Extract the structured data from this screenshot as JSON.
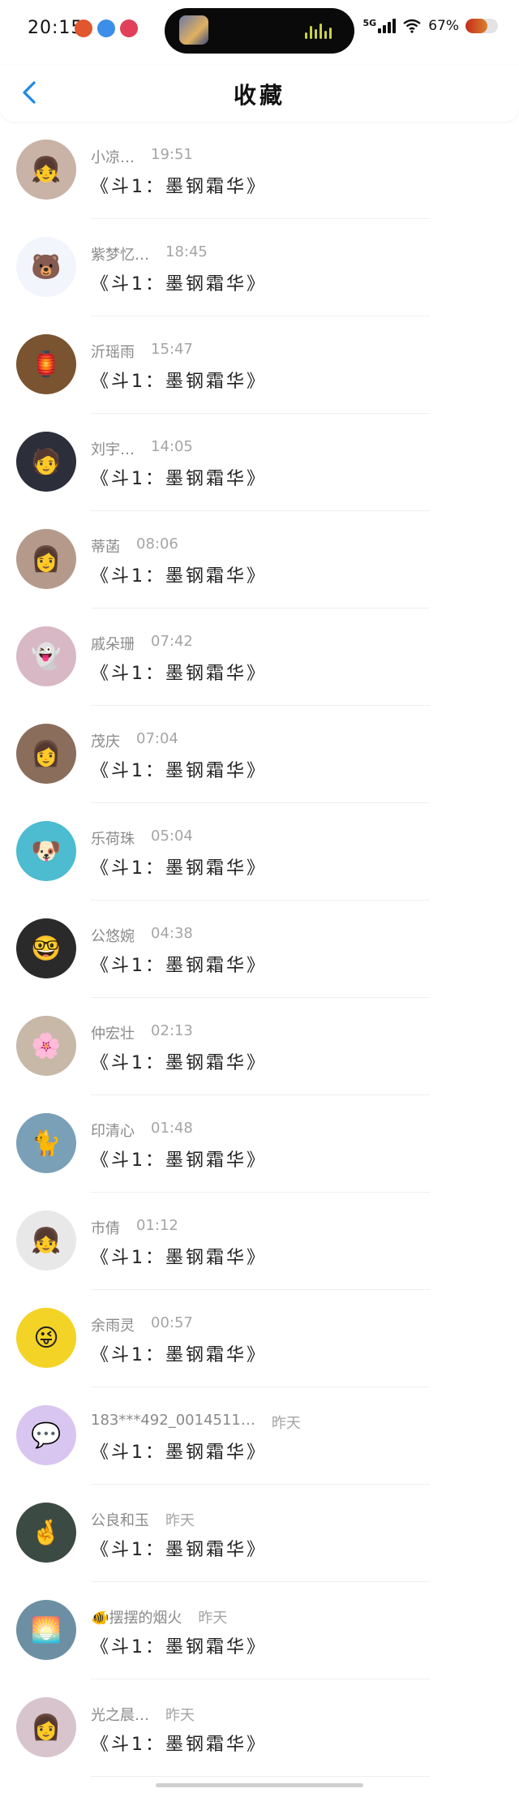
{
  "status_bar": {
    "time": "20:15",
    "network": "5G",
    "battery_label": "67%",
    "battery_level": 0.67,
    "left_icons": [
      "app-icon-red",
      "app-icon-blue",
      "app-icon-pink"
    ],
    "accent_colors": {
      "battery": "#c42b1c",
      "island_bars": "#c9d24a"
    }
  },
  "header": {
    "title": "收藏",
    "back_icon": "chevron-left-icon",
    "accent": "#1e88e5"
  },
  "items": [
    {
      "name": "小凉…",
      "time": "19:51",
      "message": "《斗1：墨钢霜华》",
      "avatar_bg": "#c9b2a6",
      "avatar_glyph": "👧"
    },
    {
      "name": "紫梦忆…",
      "time": "18:45",
      "message": "《斗1：墨钢霜华》",
      "avatar_bg": "#f2f5fb",
      "avatar_glyph": "🐻"
    },
    {
      "name": "沂瑶雨",
      "time": "15:47",
      "message": "《斗1：墨钢霜华》",
      "avatar_bg": "#7a5330",
      "avatar_glyph": "🏮"
    },
    {
      "name": "刘宇…",
      "time": "14:05",
      "message": "《斗1：墨钢霜华》",
      "avatar_bg": "#2c2f3a",
      "avatar_glyph": "🧑"
    },
    {
      "name": "蒂菡",
      "time": "08:06",
      "message": "《斗1：墨钢霜华》",
      "avatar_bg": "#b59a8c",
      "avatar_glyph": "👩"
    },
    {
      "name": "戚朵珊",
      "time": "07:42",
      "message": "《斗1：墨钢霜华》",
      "avatar_bg": "#d8b8c4",
      "avatar_glyph": "👻"
    },
    {
      "name": "茂庆",
      "time": "07:04",
      "message": "《斗1：墨钢霜华》",
      "avatar_bg": "#8a6d5a",
      "avatar_glyph": "👩"
    },
    {
      "name": "乐荷珠",
      "time": "05:04",
      "message": "《斗1：墨钢霜华》",
      "avatar_bg": "#4dbbd0",
      "avatar_glyph": "🐶"
    },
    {
      "name": "公悠婉",
      "time": "04:38",
      "message": "《斗1：墨钢霜华》",
      "avatar_bg": "#2a2a2a",
      "avatar_glyph": "🤓"
    },
    {
      "name": "仲宏壮",
      "time": "02:13",
      "message": "《斗1：墨钢霜华》",
      "avatar_bg": "#c7b8a8",
      "avatar_glyph": "🌸"
    },
    {
      "name": "印清心",
      "time": "01:48",
      "message": "《斗1：墨钢霜华》",
      "avatar_bg": "#7aa0b8",
      "avatar_glyph": "🐈"
    },
    {
      "name": "市倩",
      "time": "01:12",
      "message": "《斗1：墨钢霜华》",
      "avatar_bg": "#e8e8e8",
      "avatar_glyph": "👧"
    },
    {
      "name": "余雨灵",
      "time": "00:57",
      "message": "《斗1：墨钢霜华》",
      "avatar_bg": "#f3d326",
      "avatar_glyph": "😜"
    },
    {
      "name": "183***492_0014511…",
      "time": "昨天",
      "message": "《斗1：墨钢霜华》",
      "avatar_bg": "#d9c6f0",
      "avatar_glyph": "💬"
    },
    {
      "name": "公良和玉",
      "time": "昨天",
      "message": "《斗1：墨钢霜华》",
      "avatar_bg": "#3c4a44",
      "avatar_glyph": "🤞"
    },
    {
      "name": "🐠摆摆的烟火",
      "time": "昨天",
      "message": "《斗1：墨钢霜华》",
      "avatar_bg": "#6c8fa3",
      "avatar_glyph": "🌅"
    },
    {
      "name": "光之晨…",
      "time": "昨天",
      "message": "《斗1：墨钢霜华》",
      "avatar_bg": "#d8c4cc",
      "avatar_glyph": "👩"
    }
  ]
}
